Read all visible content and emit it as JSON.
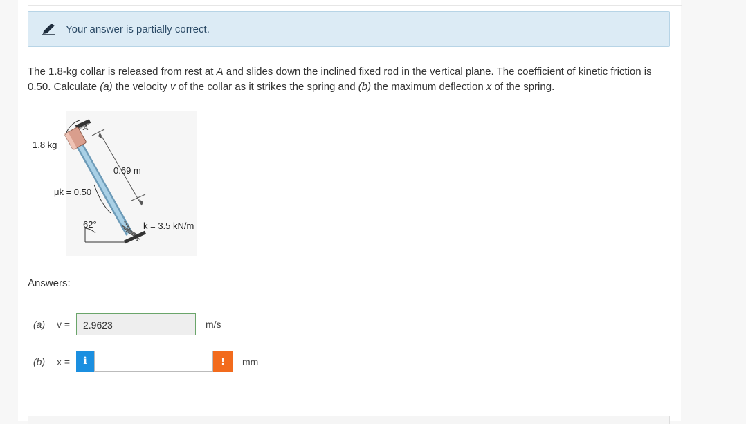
{
  "status": {
    "message": "Your answer is partially correct.",
    "icon": "pencil-icon",
    "color": "#dcebf5"
  },
  "question": {
    "part1": "The 1.8-kg collar is released from rest at ",
    "pointA": "A",
    "part2": " and slides down the inclined fixed rod in the vertical plane. The coefficient of kinetic friction is 0.50. Calculate ",
    "labelA": "(a)",
    "part3": " the velocity ",
    "varV": "v",
    "part4": " of the collar as it strikes the spring and ",
    "labelB": "(b)",
    "part5": " the maximum deflection ",
    "varX": "x",
    "part6": " of the spring."
  },
  "figure": {
    "mass": "1.8 kg",
    "point": "A",
    "distance": "0.69 m",
    "friction": "μk = 0.50",
    "angle": "62°",
    "spring": "k = 3.5 kN/m"
  },
  "answers": {
    "heading": "Answers:",
    "a": {
      "label": "(a)",
      "var": "v =",
      "value": "2.9623",
      "unit": "m/s",
      "state_color": "#6aa56a"
    },
    "b": {
      "label": "(b)",
      "var": "x =",
      "value": "",
      "unit": "mm",
      "info_icon": "i",
      "warn_icon": "!",
      "state_color": "#f26b1d"
    }
  }
}
